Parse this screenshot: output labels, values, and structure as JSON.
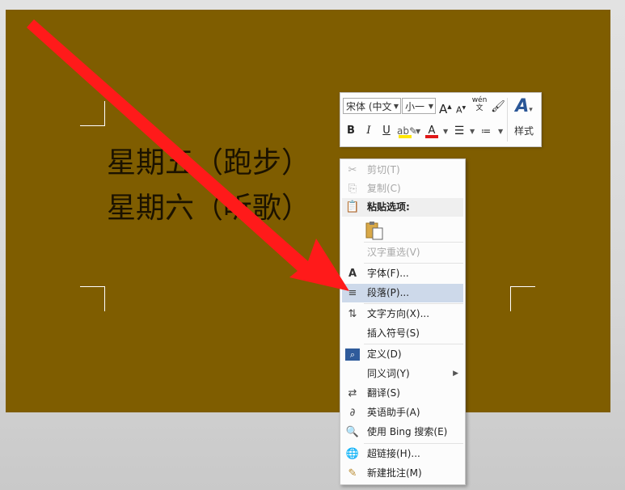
{
  "document": {
    "lines": [
      "星期五（跑步）",
      "星期六（听歌）"
    ],
    "page_color": "#7f5d00"
  },
  "mini_toolbar": {
    "font_name": "宋体 (中文",
    "font_size": "小一",
    "grow_font": "A",
    "shrink_font": "A",
    "pinyin": "wén\n文",
    "bold": "B",
    "italic": "I",
    "underline": "U",
    "font_color": "A",
    "styles_label": "样式"
  },
  "context_menu": {
    "cut": "剪切(T)",
    "copy": "复制(C)",
    "paste_options": "粘贴选项:",
    "reconvert": "汉字重选(V)",
    "font": "字体(F)...",
    "paragraph": "段落(P)...",
    "text_direction": "文字方向(X)...",
    "insert_symbol": "插入符号(S)",
    "define": "定义(D)",
    "synonyms": "同义词(Y)",
    "translate": "翻译(S)",
    "english_assistant": "英语助手(A)",
    "bing_search": "使用 Bing 搜索(E)",
    "hyperlink": "超链接(H)...",
    "new_comment": "新建批注(M)"
  },
  "colors": {
    "arrow": "#ff1a1a",
    "menu_highlight": "#cdd9ea",
    "highlight_yellow": "#ffe600",
    "font_red": "#e01818"
  }
}
